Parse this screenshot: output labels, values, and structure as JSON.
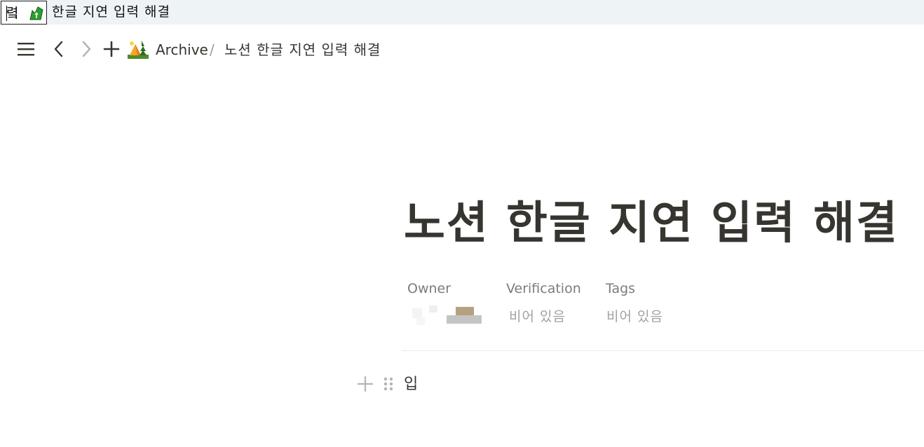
{
  "ime": {
    "composing_char": "렼",
    "composing_text": "한글 지연 입력 해결"
  },
  "topbar": {
    "breadcrumb": {
      "parent": "Archive",
      "separator": "/",
      "current": "노션 한글 지연 입력 해결"
    }
  },
  "page": {
    "title": "노션 한글 지연 입력 해결",
    "properties": [
      {
        "label": "Owner",
        "value": ""
      },
      {
        "label": "Verification",
        "value": "비어 있음"
      },
      {
        "label": "Tags",
        "value": "비어 있음"
      }
    ],
    "blocks": [
      {
        "text": "입"
      }
    ]
  },
  "icons": {
    "menu": "hamburger-menu-icon",
    "back": "chevron-left-icon",
    "forward": "chevron-right-icon",
    "new": "plus-icon",
    "page_emoji": "camping-tent-icon",
    "block_add": "plus-icon",
    "drag": "drag-handle-icon"
  },
  "colors": {
    "text": "#37352f",
    "muted": "#7d7c78",
    "placeholder": "#a3a29e",
    "ime_bar": "#eef3f6"
  }
}
